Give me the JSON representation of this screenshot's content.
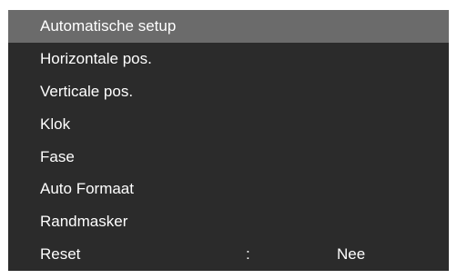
{
  "menu": {
    "items": [
      {
        "label": "Automatische setup",
        "selected": true
      },
      {
        "label": "Horizontale pos."
      },
      {
        "label": "Verticale pos."
      },
      {
        "label": "Klok"
      },
      {
        "label": "Fase"
      },
      {
        "label": "Auto Formaat"
      },
      {
        "label": "Randmasker"
      },
      {
        "label": "Reset",
        "separator": ":",
        "value": "Nee"
      }
    ]
  },
  "colors": {
    "menu_background": "#2b2b2b",
    "selected_background": "#6b6b6b",
    "text": "#ffffff"
  }
}
